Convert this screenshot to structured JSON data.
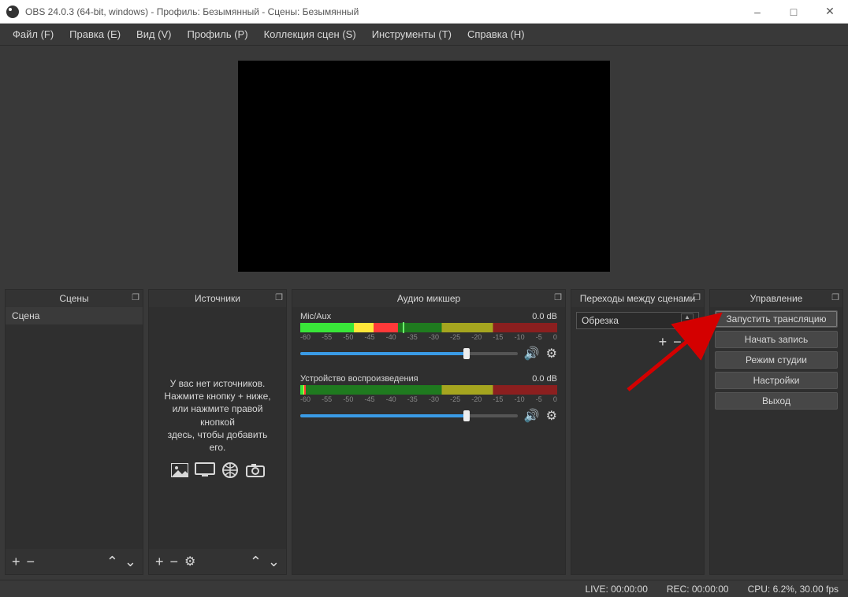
{
  "titlebar": {
    "title": "OBS 24.0.3 (64-bit, windows) - Профиль: Безымянный - Сцены: Безымянный"
  },
  "menu": {
    "file": "Файл (F)",
    "edit": "Правка (E)",
    "view": "Вид (V)",
    "profile": "Профиль (P)",
    "scene_collection": "Коллекция сцен (S)",
    "tools": "Инструменты (T)",
    "help": "Справка (H)"
  },
  "docks": {
    "scenes_title": "Сцены",
    "sources_title": "Источники",
    "mixer_title": "Аудио микшер",
    "transitions_title": "Переходы между сценами",
    "controls_title": "Управление"
  },
  "scenes": {
    "items": [
      {
        "name": "Сцена"
      }
    ]
  },
  "sources": {
    "empty_line1": "У вас нет источников.",
    "empty_line2": "Нажмите кнопку + ниже,",
    "empty_line3": "или нажмите правой кнопкой",
    "empty_line4": "здесь, чтобы добавить его."
  },
  "mixer": {
    "ticks": [
      "-60",
      "-55",
      "-50",
      "-45",
      "-40",
      "-35",
      "-30",
      "-25",
      "-20",
      "-15",
      "-10",
      "-5",
      "0"
    ],
    "channels": [
      {
        "name": "Mic/Aux",
        "level": "0.0 dB"
      },
      {
        "name": "Устройство воспроизведения",
        "level": "0.0 dB"
      }
    ]
  },
  "transitions": {
    "selected": "Обрезка"
  },
  "controls": {
    "start_stream": "Запустить трансляцию",
    "start_record": "Начать запись",
    "studio_mode": "Режим студии",
    "settings": "Настройки",
    "exit": "Выход"
  },
  "status": {
    "live": "LIVE: 00:00:00",
    "rec": "REC: 00:00:00",
    "cpu": "CPU: 6.2%, 30.00 fps"
  }
}
